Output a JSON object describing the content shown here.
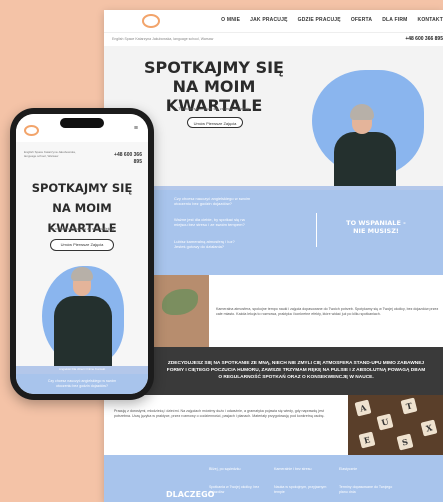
{
  "desktop": {
    "nav": [
      "O MNIE",
      "JAK PRACUJĘ",
      "GDZIE PRACUJĘ",
      "OFERTA",
      "DLA FIRM",
      "KONTAKT"
    ],
    "top_small": "English Space Katarzyna Jakubowska, language school, Warsaw",
    "top_phone": "+48 600 366 895",
    "hero_title_line1": "SPOTKAJMY SIĘ",
    "hero_title_line2": "NA MOIM KWARTALE",
    "hero_sub": "Tu możesz umówić się ze mną na lekcję",
    "hero_button": "Umów Pierwsze Zajęcia",
    "menu_strip": [
      "Angielski",
      "Dla dzieci",
      "Online",
      "Kontakt",
      "Opinie"
    ],
    "blue_lines": [
      "Czy chcesz nauczyć angielskiego w swoim",
      "otoczeniu bez godzin dojazdów?",
      "Ważne jest dla ciebie, by spotkać się na",
      "miejscu bez stresu i ze swoim tempem?",
      "Lubisz kameralną atmosferę i luz?",
      "Jesteś gotowy do działania?"
    ],
    "highlight_line1": "TO WSPANIALE -",
    "highlight_line2": "NIE MUSISZ!",
    "photo_text": "Kameralna atmosfera, spokojne tempo nauki i zajęcia dopasowane do Twoich potrzeb. Spotykamy się w Twojej okolicy, bez dojazdów przez całe miasto. Każda lekcja to rozmowa, praktyka i konkretne efekty, które widać już po kilku spotkaniach.",
    "dark_line1": "ZDECYDUJESZ SIĘ NA SPOTKANIE ZE MNĄ, NIECH NIE ZMYLI CIĘ ATMOSFERA STAND-UPU MIMO ZABAWNEJ",
    "dark_line2": "FORMY I CIĘTEGO POCZUCIA HUMORU, ZAWSZE TRZYMAM RĘKĘ NA PULSIE I Z ABSOLUTNĄ POWAGĄ DBAM",
    "dark_line3": "O REGULARNOŚĆ SPOTKAŃ ORAZ O KONSEKWENCJĘ W NAUCE.",
    "cards_text": "Pracuję z dorosłymi, młodzieżą i dziećmi. Na zajęciach mówimy dużo i odważnie, a gramatyka pojawia się wtedy, gdy naprawdę jest potrzebna. Uczę języka w praktyce, przez rozmowy o codzienności, pasjach i planach. Materiały przygotowuję pod konkretną osobę.",
    "tiles": [
      "A",
      "U",
      "T",
      "X",
      "E",
      "S"
    ],
    "why_title": "DLACZEGO",
    "why_cols": [
      {
        "head": "Bliżej, po sąsiedzku",
        "body": "Spotkania w Twojej okolicy, bez dojazdów"
      },
      {
        "head": "Kameralnie i bez stresu",
        "body": "Nauka w spokojnym, przyjaznym tempie"
      },
      {
        "head": "Elastycznie",
        "body": "Terminy dopasowane do Twojego planu dnia"
      }
    ]
  },
  "phone": {
    "menu_icon": "≡",
    "small": "English Space Katarzyna Jakubowska, language school, Warsaw",
    "phone_line1": "+48 600 366",
    "phone_line2": "895",
    "title_line1": "SPOTKAJMY SIĘ",
    "title_line2": "NA MOIM KWARTALE",
    "sub": "Tu możesz umówić się ze mną na lekcję",
    "button": "Umów Pierwsze Zajęcia",
    "strip": "Angielski   Dla dzieci   Online   Kontakt",
    "blue_line1": "Czy chcesz nauczyć angielskiego w swoim",
    "blue_line2": "otoczeniu bez godzin dojazdów?"
  }
}
